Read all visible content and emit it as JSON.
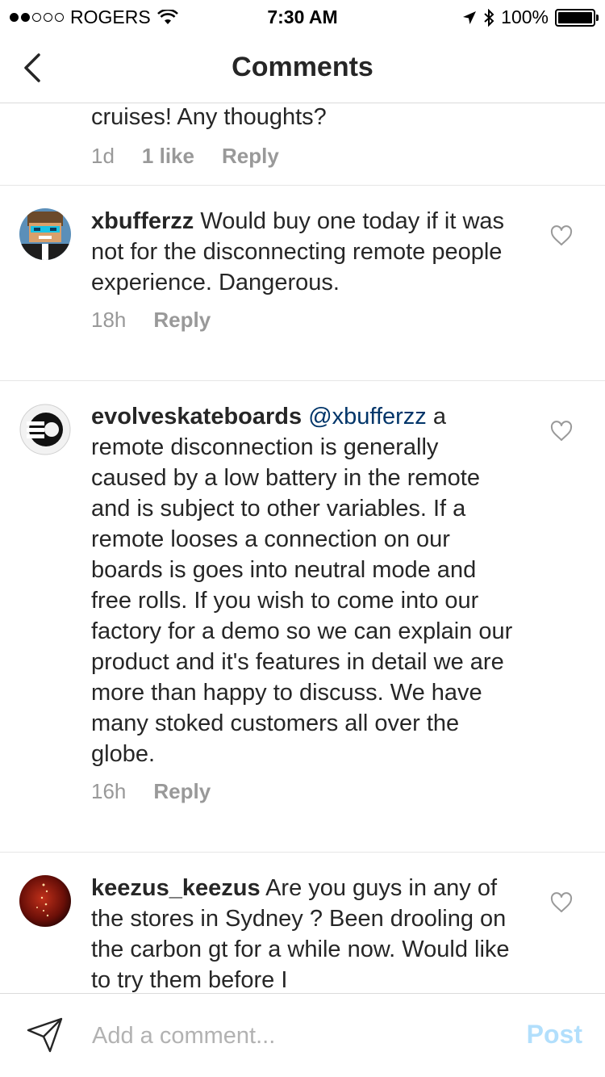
{
  "status_bar": {
    "carrier": "ROGERS",
    "time": "7:30 AM",
    "battery": "100%",
    "signal_bars_filled": 2,
    "signal_bars_total": 5
  },
  "header": {
    "title": "Comments",
    "back_icon": "chevron-left-icon"
  },
  "comments": [
    {
      "partial": true,
      "text": "cruises! Any thoughts?",
      "time": "1d",
      "likes": "1 like",
      "reply": "Reply"
    },
    {
      "username": "xbufferzz",
      "text": "Would buy one today if it was not for the disconnecting remote people experience. Dangerous.",
      "time": "18h",
      "reply": "Reply",
      "avatar": "pixel-character-avatar"
    },
    {
      "username": "evolveskateboards",
      "mention": "@xbufferzz",
      "text": "a remote disconnection is generally caused by a low battery in the remote and is subject to other variables.  If a remote looses a connection on our boards is goes into neutral mode and free rolls.  If you wish to come into our factory for a demo so we can explain our product and it's features in detail we are more than happy to discuss.  We have many stoked customers all over the globe.",
      "time": "16h",
      "reply": "Reply",
      "avatar": "evolve-logo-avatar"
    },
    {
      "username": "keezus_keezus",
      "text": "Are you guys in any of the stores in Sydney ? Been drooling on the carbon gt for a while now. Would like to try them before I",
      "avatar": "red-dark-avatar"
    }
  ],
  "composer": {
    "placeholder": "Add a comment...",
    "post_label": "Post",
    "send_icon": "paper-plane-icon"
  },
  "colors": {
    "text": "#262626",
    "secondary": "#999999",
    "mention": "#003569",
    "post_disabled": "#b2dffc",
    "divider": "#e6e6e6"
  }
}
